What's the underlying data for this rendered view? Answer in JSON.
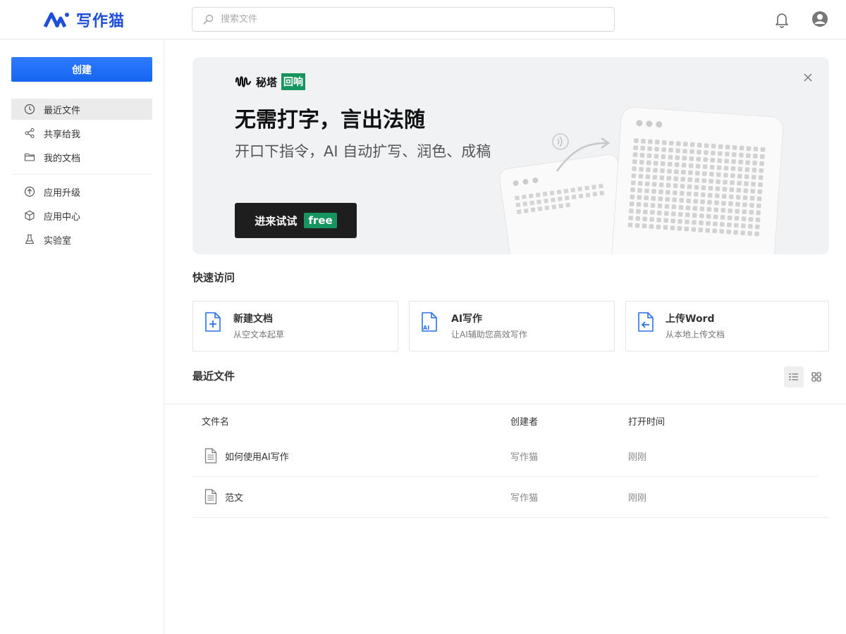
{
  "header": {
    "logo_text": "写作猫",
    "search_placeholder": "搜索文件",
    "accent": "#1f4fd8"
  },
  "sidebar": {
    "create_label": "创建",
    "items": [
      {
        "label": "最近文件",
        "icon": "clock-icon",
        "active": true
      },
      {
        "label": "共享给我",
        "icon": "share-icon"
      },
      {
        "label": "我的文档",
        "icon": "folder-icon"
      },
      {
        "label": "应用升级",
        "icon": "upgrade-icon"
      },
      {
        "label": "应用中心",
        "icon": "cube-icon"
      },
      {
        "label": "实验室",
        "icon": "flask-icon"
      }
    ]
  },
  "banner": {
    "brand_name": "秘塔",
    "brand_tag": "回响",
    "title": "无需打字，言出法随",
    "subtitle": "开口下指令，AI 自动扩写、润色、成稿",
    "cta_label": "进来试试",
    "cta_badge": "free",
    "tag_color": "#17955e"
  },
  "quick": {
    "title": "快速访问",
    "cards": [
      {
        "title": "新建文档",
        "desc": "从空文本起草",
        "icon": "new-doc-icon"
      },
      {
        "title": "AI写作",
        "desc": "让AI辅助您高效写作",
        "icon": "ai-doc-icon"
      },
      {
        "title": "上传Word",
        "desc": "从本地上传文档",
        "icon": "upload-doc-icon"
      }
    ]
  },
  "recent": {
    "title": "最近文件",
    "columns": [
      "文件名",
      "创建者",
      "打开时间"
    ],
    "rows": [
      {
        "name": "如何使用AI写作",
        "creator": "写作猫",
        "time": "刚刚"
      },
      {
        "name": "范文",
        "creator": "写作猫",
        "time": "刚刚"
      }
    ]
  }
}
